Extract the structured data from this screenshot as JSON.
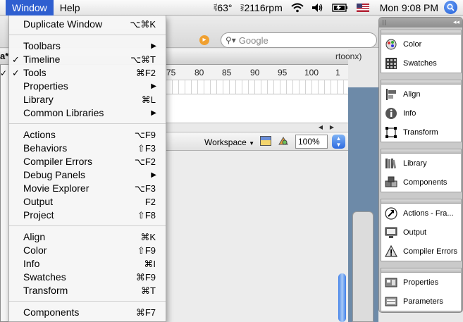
{
  "menubar": {
    "items": [
      {
        "label": "Window",
        "active": true
      },
      {
        "label": "Help",
        "active": false
      }
    ],
    "status": {
      "temp_label": "TMP",
      "temp_value": "63°",
      "fan_label": "FAN",
      "fan_value": "2116rpm",
      "clock": "Mon 9:08 PM",
      "icons": [
        "wifi-icon",
        "volume-icon",
        "battery-icon",
        "flag-icon",
        "spotlight-icon"
      ]
    }
  },
  "browser": {
    "search_placeholder": "Google"
  },
  "document": {
    "tab_label": "rtoonx)",
    "left_text": "a*",
    "ruler_numbers": [
      "75",
      "80",
      "85",
      "90",
      "95",
      "100",
      "1"
    ],
    "workspace_label": "Workspace",
    "zoom_value": "100%"
  },
  "window_menu": {
    "groups": [
      [
        {
          "label": "Duplicate Window",
          "shortcut": "⌥⌘K"
        }
      ],
      [
        {
          "label": "Toolbars",
          "submenu": true
        },
        {
          "label": "Timeline",
          "shortcut": "⌥⌘T",
          "checked": true
        },
        {
          "label": "Tools",
          "shortcut": "⌘F2",
          "checked": true
        },
        {
          "label": "Properties",
          "submenu": true
        },
        {
          "label": "Library",
          "shortcut": "⌘L"
        },
        {
          "label": "Common Libraries",
          "submenu": true
        }
      ],
      [
        {
          "label": "Actions",
          "shortcut": "⌥F9"
        },
        {
          "label": "Behaviors",
          "shortcut": "⇧F3"
        },
        {
          "label": "Compiler Errors",
          "shortcut": "⌥F2"
        },
        {
          "label": "Debug Panels",
          "submenu": true
        },
        {
          "label": "Movie Explorer",
          "shortcut": "⌥F3"
        },
        {
          "label": "Output",
          "shortcut": "F2"
        },
        {
          "label": "Project",
          "shortcut": "⇧F8"
        }
      ],
      [
        {
          "label": "Align",
          "shortcut": "⌘K"
        },
        {
          "label": "Color",
          "shortcut": "⇧F9"
        },
        {
          "label": "Info",
          "shortcut": "⌘I"
        },
        {
          "label": "Swatches",
          "shortcut": "⌘F9"
        },
        {
          "label": "Transform",
          "shortcut": "⌘T"
        }
      ],
      [
        {
          "label": "Components",
          "shortcut": "⌘F7"
        }
      ]
    ]
  },
  "dock": {
    "groups": [
      [
        {
          "label": "Color",
          "icon": "color-icon"
        },
        {
          "label": "Swatches",
          "icon": "swatches-icon"
        }
      ],
      [
        {
          "label": "Align",
          "icon": "align-icon"
        },
        {
          "label": "Info",
          "icon": "info-icon"
        },
        {
          "label": "Transform",
          "icon": "transform-icon"
        }
      ],
      [
        {
          "label": "Library",
          "icon": "library-icon"
        },
        {
          "label": "Components",
          "icon": "components-icon"
        }
      ],
      [
        {
          "label": "Actions - Fra...",
          "icon": "actions-icon"
        },
        {
          "label": "Output",
          "icon": "output-icon"
        },
        {
          "label": "Compiler Errors",
          "icon": "warning-icon"
        }
      ],
      [
        {
          "label": "Properties",
          "icon": "properties-icon"
        },
        {
          "label": "Parameters",
          "icon": "parameters-icon"
        }
      ]
    ]
  }
}
